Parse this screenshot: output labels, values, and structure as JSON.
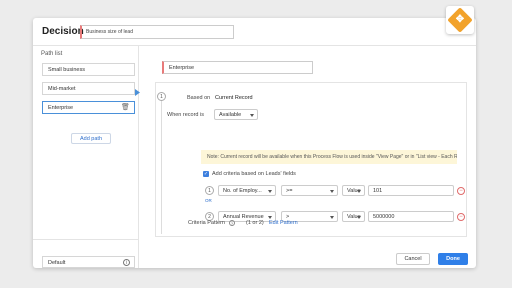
{
  "header": {
    "title": "Decision",
    "name_value": "Business size of lead"
  },
  "path_list": {
    "label": "Path list",
    "items": [
      "Small business",
      "Mid-market",
      "Enterprise"
    ],
    "add_label": "Add path",
    "default_label": "Default"
  },
  "editor": {
    "path_name": "Enterprise",
    "based_on_label": "Based on",
    "based_on_value": "Current Record",
    "when_label": "When record is",
    "when_value": "Available",
    "note": "Note: Current record will be available when this Process Flow is used inside \"View Page\" or in \"List view - Each Record\".",
    "criteria_checkbox": "Add criteria based on Leads' fields",
    "criteria": [
      {
        "num": "1",
        "field": "No. of Employ...",
        "operator": ">=",
        "value_type": "Value",
        "value": "101"
      },
      {
        "num": "2",
        "field": "Annual Revenue",
        "operator": ">",
        "value_type": "Value",
        "value": "5000000"
      }
    ],
    "connector": "OR",
    "pattern_label": "Criteria Pattern",
    "pattern_value": "(1 or 2)",
    "edit_pattern": "Edit Pattern",
    "step_num": "1"
  },
  "footer": {
    "cancel": "Cancel",
    "done": "Done"
  },
  "colors": {
    "accent": "#2f7fe8",
    "badge": "#f2a22a",
    "required": "#e87a7a"
  }
}
